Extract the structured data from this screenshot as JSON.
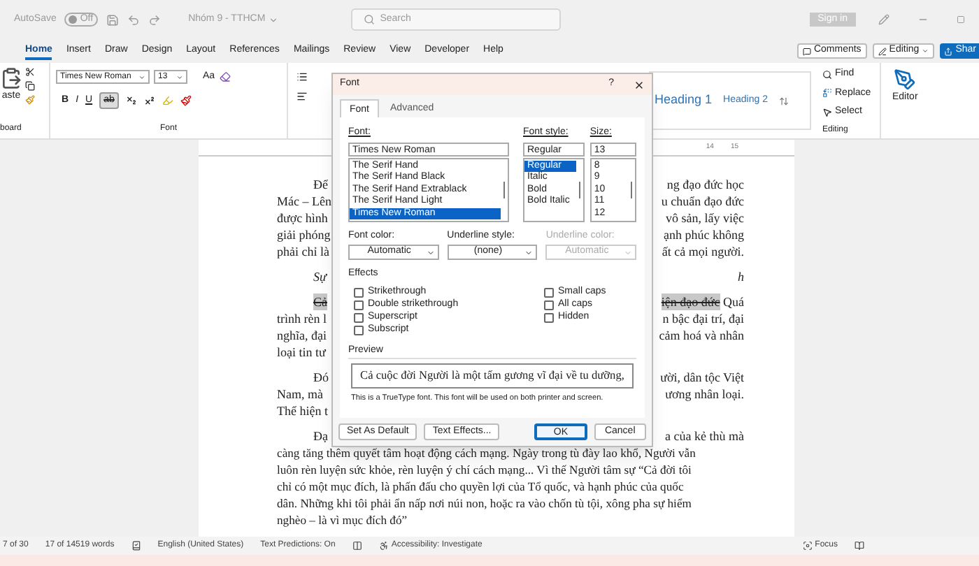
{
  "title_bar": {
    "autosave_label": "AutoSave",
    "autosave_state": "Off",
    "autosave_on": false,
    "document_title": "Nhóm 9 - TTHCM",
    "search_placeholder": "Search",
    "sign_in": "Sign in"
  },
  "tabs": [
    {
      "label": "Home",
      "selected": true
    },
    {
      "label": "Insert",
      "selected": false
    },
    {
      "label": "Draw",
      "selected": false
    },
    {
      "label": "Design",
      "selected": false
    },
    {
      "label": "Layout",
      "selected": false
    },
    {
      "label": "References",
      "selected": false
    },
    {
      "label": "Mailings",
      "selected": false
    },
    {
      "label": "Review",
      "selected": false
    },
    {
      "label": "View",
      "selected": false
    },
    {
      "label": "Developer",
      "selected": false
    },
    {
      "label": "Help",
      "selected": false
    }
  ],
  "ribbon_actions": {
    "comments": "Comments",
    "editing": "Editing",
    "share": "Shar"
  },
  "ribbon": {
    "clipboard": {
      "paste": "aste",
      "label": "board"
    },
    "font": {
      "font_name": "Times New Roman",
      "font_size": "13",
      "change_case": "Aa",
      "bold": "B",
      "italic": "I",
      "underline": "U",
      "strikethrough": "ab",
      "strikethrough_on": true,
      "label": "Font"
    },
    "styles": [
      {
        "label": "Heading 1"
      },
      {
        "label": "Heading 2"
      }
    ],
    "editing": {
      "find": "Find",
      "replace": "Replace",
      "select": "Select",
      "label": "Editing"
    },
    "editor": "Editor"
  },
  "ruler": {
    "labels": [
      "14",
      "15"
    ]
  },
  "document": {
    "paragraphs": [
      {
        "kind": "body",
        "lines": [
          {
            "left": "Để",
            "right": "ng đạo đức học"
          },
          {
            "left": "Mác – Lên",
            "right": "u chuẩn đạo đức"
          },
          {
            "left": "được hình",
            "right": "vô sản, lấy việc"
          },
          {
            "left": "giải phóng",
            "right": "ạnh phúc không"
          },
          {
            "left": "phải chỉ là",
            "right": "ất cả mọi người."
          }
        ]
      },
      {
        "kind": "heading",
        "lines": [
          {
            "left": "Sự",
            "right": "h"
          }
        ]
      },
      {
        "kind": "body",
        "lines": [
          {
            "left": [
              {
                "text": "Cả",
                "selected": true
              }
            ],
            "right": [
              {
                "text": "iện đạo đức",
                "selected": true
              },
              {
                "text": " Quá",
                "selected": false
              }
            ]
          },
          {
            "left": "trình rèn l",
            "right": "n bậc đại trí, đại"
          },
          {
            "left": "nghĩa, đại",
            "right": "cảm hoá và nhân"
          },
          {
            "left": "loại tin tư"
          }
        ]
      },
      {
        "kind": "body",
        "lines": [
          {
            "left": "Đó",
            "right": "ười, dân tộc Việt"
          },
          {
            "left": "Nam, mà",
            "right": "ương nhân loại."
          },
          {
            "left": "Thể hiện t"
          }
        ]
      },
      {
        "kind": "body",
        "lines": [
          {
            "left": "Đạ",
            "right": "a của kẻ thù mà"
          },
          {
            "full": "càng tăng thêm quyết tâm hoạt động cách mạng. Ngày trong tù đày lao khổ, Người vẫn"
          },
          {
            "full": "luôn rèn luyện sức khỏe, rèn luyện ý chí cách mạng... Vì thế Người tâm sự “Cả đời tôi"
          },
          {
            "full": "chỉ có một mục đích, là phấn đấu cho quyền lợi của Tổ quốc, và hạnh phúc của quốc"
          },
          {
            "full": "dân. Những khi tôi phải ẩn nấp nơi núi non, hoặc ra vào chốn tù tội, xông pha sự hiểm"
          },
          {
            "full": "nghèo – là vì mục đích đó”"
          }
        ]
      }
    ]
  },
  "dialog": {
    "title": "Font",
    "help": "?",
    "tabs": [
      {
        "label": "Font",
        "selected": true
      },
      {
        "label": "Advanced",
        "selected": false
      }
    ],
    "font_label": "Font:",
    "font_value": "Times New Roman",
    "fonts": [
      {
        "label": "The Serif Hand",
        "selected": false
      },
      {
        "label": "The Serif Hand Black",
        "selected": false
      },
      {
        "label": "The Serif Hand Extrablack",
        "selected": false
      },
      {
        "label": "The Serif Hand Light",
        "selected": false
      },
      {
        "label": "Times New Roman",
        "selected": true
      }
    ],
    "style_label": "Font style:",
    "style_value": "Regular",
    "styles": [
      {
        "label": "Regular",
        "selected": true
      },
      {
        "label": "Italic",
        "selected": false
      },
      {
        "label": "Bold",
        "selected": false
      },
      {
        "label": "Bold Italic",
        "selected": false
      }
    ],
    "size_label": "Size:",
    "size_value": "13",
    "sizes": [
      {
        "label": "8",
        "selected": false
      },
      {
        "label": "9",
        "selected": false
      },
      {
        "label": "10",
        "selected": false
      },
      {
        "label": "11",
        "selected": false
      },
      {
        "label": "12",
        "selected": false
      }
    ],
    "dropdowns": [
      {
        "label": "Font color:",
        "value": "Automatic",
        "disabled": false
      },
      {
        "label": "Underline style:",
        "value": "(none)",
        "disabled": false
      },
      {
        "label": "Underline color:",
        "value": "Automatic",
        "disabled": true
      }
    ],
    "effects_label": "Effects",
    "effects_left": [
      {
        "label": "Strikethrough",
        "checked": false
      },
      {
        "label": "Double strikethrough",
        "checked": false
      },
      {
        "label": "Superscript",
        "checked": false
      },
      {
        "label": "Subscript",
        "checked": false
      }
    ],
    "effects_right": [
      {
        "label": "Small caps",
        "checked": false
      },
      {
        "label": "All caps",
        "checked": false
      },
      {
        "label": "Hidden",
        "checked": false
      }
    ],
    "preview_label": "Preview",
    "preview_text": "Cả cuộc đời Người là một tấm gương vĩ đại về tu dưỡng,",
    "note": "This is a TrueType font. This font will be used on both printer and screen.",
    "buttons": [
      {
        "label": "Set As Default",
        "primary": false
      },
      {
        "label": "Text Effects...",
        "primary": false
      },
      {
        "label": "OK",
        "primary": true
      },
      {
        "label": "Cancel",
        "primary": false
      }
    ]
  },
  "status_bar": {
    "page": "7 of 30",
    "words": "17 of 14519 words",
    "language": "English (United States)",
    "predictions": "Text Predictions: On",
    "accessibility": "Accessibility: Investigate",
    "focus": "Focus"
  }
}
